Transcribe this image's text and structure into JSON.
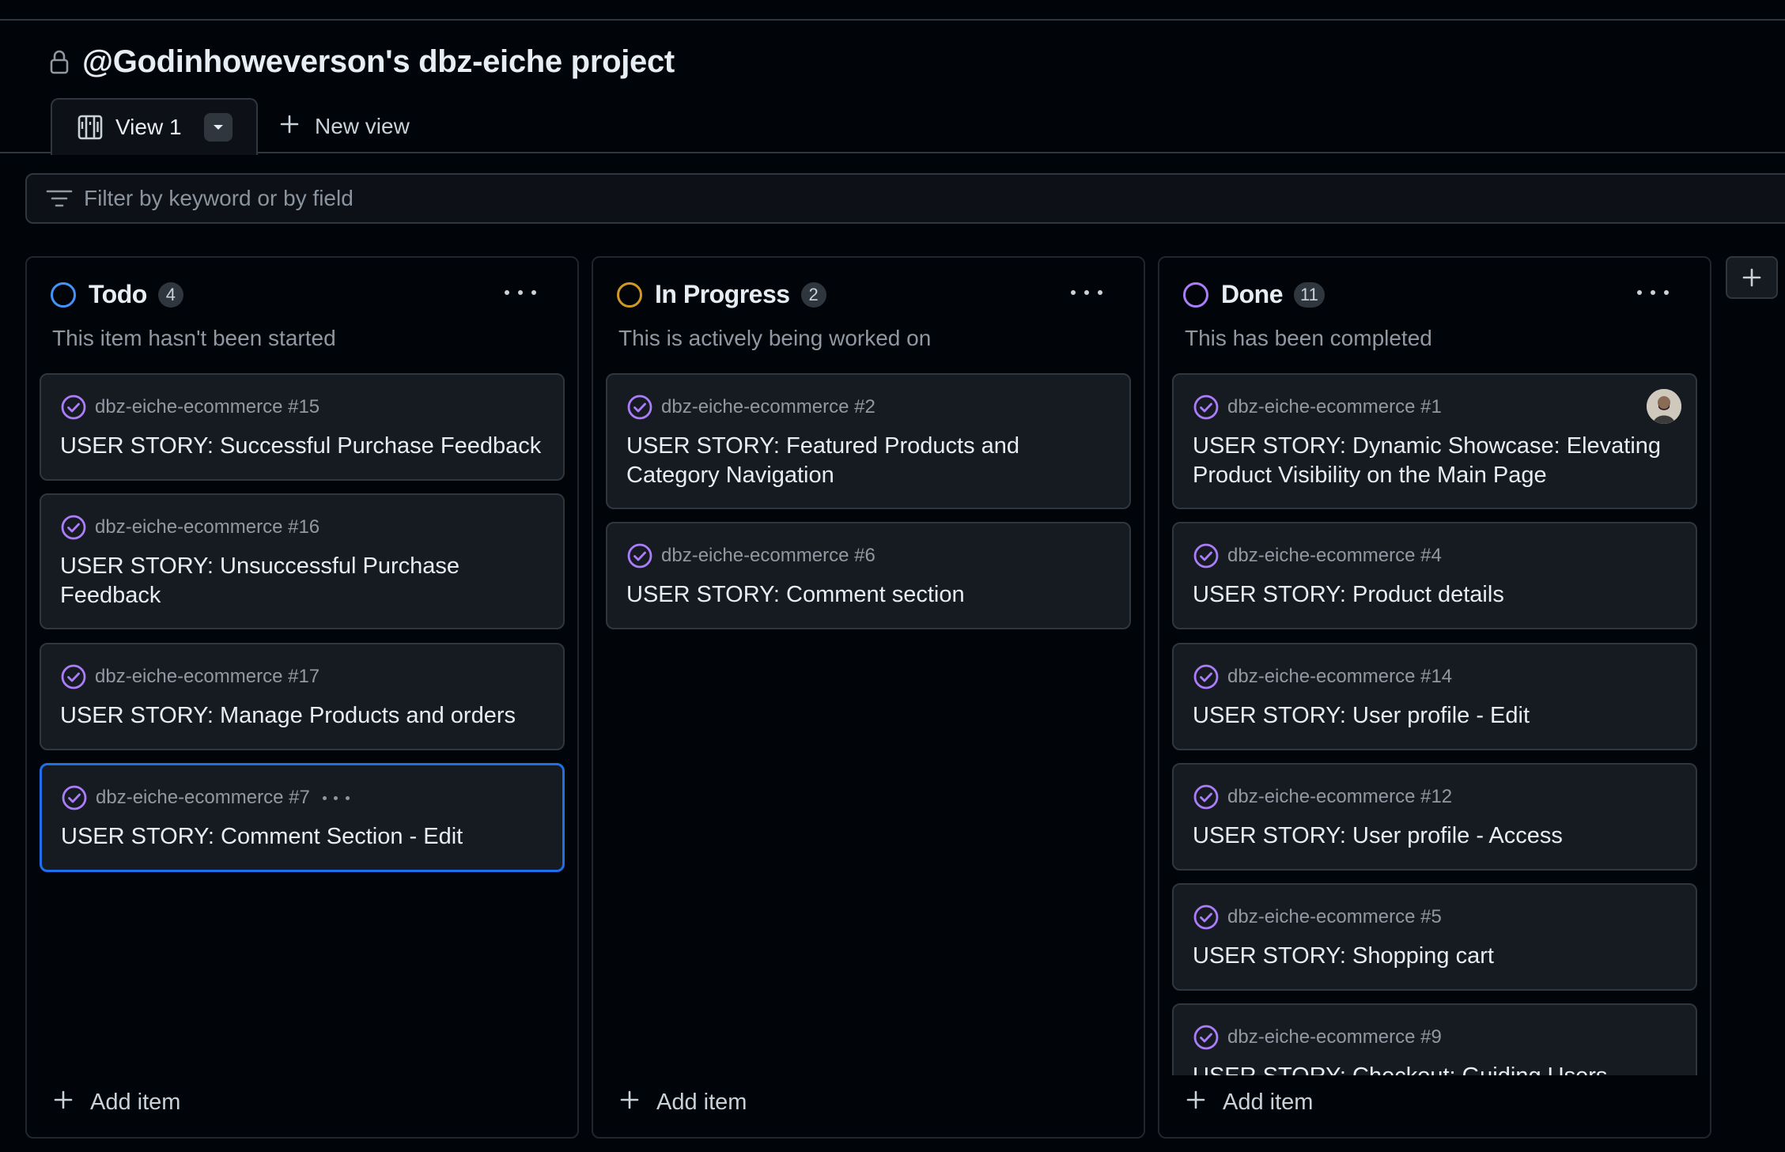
{
  "project": {
    "title": "@Godinhoweverson's dbz-eiche project"
  },
  "tabs": {
    "view_label": "View 1",
    "new_view_label": "New view"
  },
  "filter": {
    "placeholder": "Filter by keyword or by field"
  },
  "colors": {
    "todo": "#4493f8",
    "in_progress": "#d29922",
    "done": "#ab7df8",
    "issue_icon": "#ab7df8",
    "selected_border": "#1f6feb"
  },
  "columns": [
    {
      "name": "Todo",
      "count": "4",
      "description": "This item hasn't been started",
      "add_label": "Add item",
      "cards": [
        {
          "repo": "dbz-eiche-ecommerce #15",
          "title": "USER STORY: Successful Purchase Feedback"
        },
        {
          "repo": "dbz-eiche-ecommerce #16",
          "title": "USER STORY: Unsuccessful Purchase Feedback"
        },
        {
          "repo": "dbz-eiche-ecommerce #17",
          "title": "USER STORY: Manage Products and orders"
        },
        {
          "repo": "dbz-eiche-ecommerce #7",
          "title": "USER STORY: Comment Section - Edit"
        }
      ]
    },
    {
      "name": "In Progress",
      "count": "2",
      "description": "This is actively being worked on",
      "add_label": "Add item",
      "cards": [
        {
          "repo": "dbz-eiche-ecommerce #2",
          "title": "USER STORY: Featured Products and Category Navigation"
        },
        {
          "repo": "dbz-eiche-ecommerce #6",
          "title": "USER STORY: Comment section"
        }
      ]
    },
    {
      "name": "Done",
      "count": "11",
      "description": "This has been completed",
      "add_label": "Add item",
      "cards": [
        {
          "repo": "dbz-eiche-ecommerce #1",
          "title": "USER STORY: Dynamic Showcase: Elevating Product Visibility on the Main Page"
        },
        {
          "repo": "dbz-eiche-ecommerce #4",
          "title": "USER STORY: Product details"
        },
        {
          "repo": "dbz-eiche-ecommerce #14",
          "title": "USER STORY: User profile - Edit"
        },
        {
          "repo": "dbz-eiche-ecommerce #12",
          "title": "USER STORY: User profile - Access"
        },
        {
          "repo": "dbz-eiche-ecommerce #5",
          "title": "USER STORY: Shopping cart"
        },
        {
          "repo": "dbz-eiche-ecommerce #9",
          "title": "USER STORY: Checkout: Guiding Users"
        }
      ]
    }
  ]
}
